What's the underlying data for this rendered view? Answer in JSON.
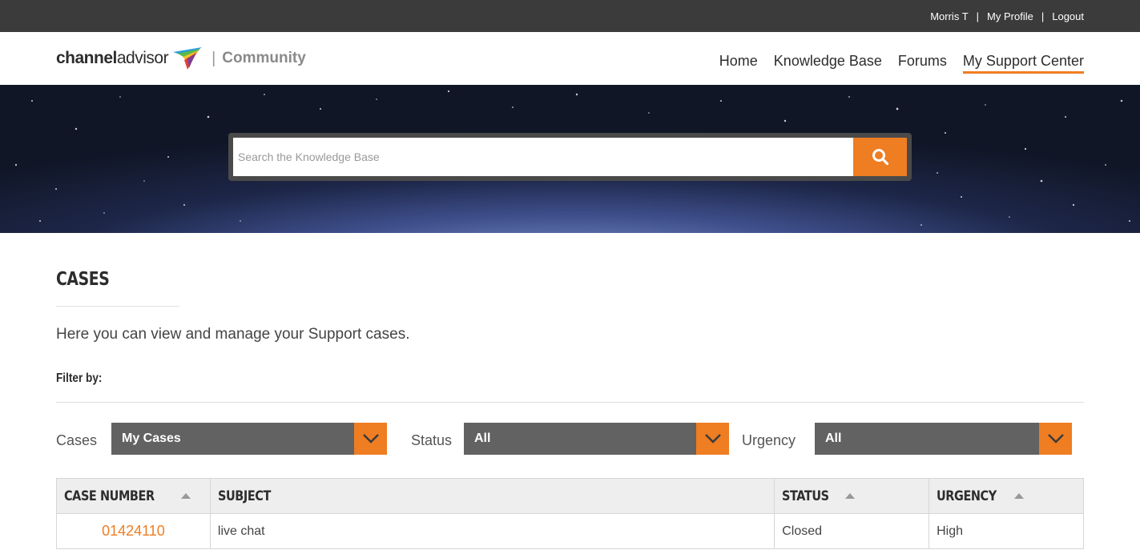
{
  "topbar": {
    "user_name": "Morris T",
    "profile_label": "My Profile",
    "logout_label": "Logout",
    "separator": "|"
  },
  "header": {
    "logo_channel": "channel",
    "logo_advisor": "advisor",
    "logo_divider": "|",
    "logo_community": "Community",
    "nav": [
      "Home",
      "Knowledge Base",
      "Forums",
      "My Support Center"
    ],
    "active_nav": "My Support Center"
  },
  "search": {
    "placeholder": "Search the Knowledge Base",
    "button_icon": "search-icon"
  },
  "main": {
    "title": "CASES",
    "intro": "Here you can view and manage your Support cases.",
    "filter_label": "Filter by:",
    "filters": {
      "cases_label": "Cases",
      "cases_value": "My Cases",
      "status_label": "Status",
      "status_value": "All",
      "urgency_label": "Urgency",
      "urgency_value": "All"
    }
  },
  "table": {
    "headers": [
      "CASE NUMBER",
      "SUBJECT",
      "STATUS",
      "URGENCY"
    ],
    "rows": [
      {
        "case_number": "01424110",
        "subject": "live chat",
        "status": "Closed",
        "urgency": "High"
      }
    ]
  },
  "colors": {
    "accent": "#ef7d22",
    "topbar": "#3b3b3b",
    "select_bg": "#626262"
  }
}
